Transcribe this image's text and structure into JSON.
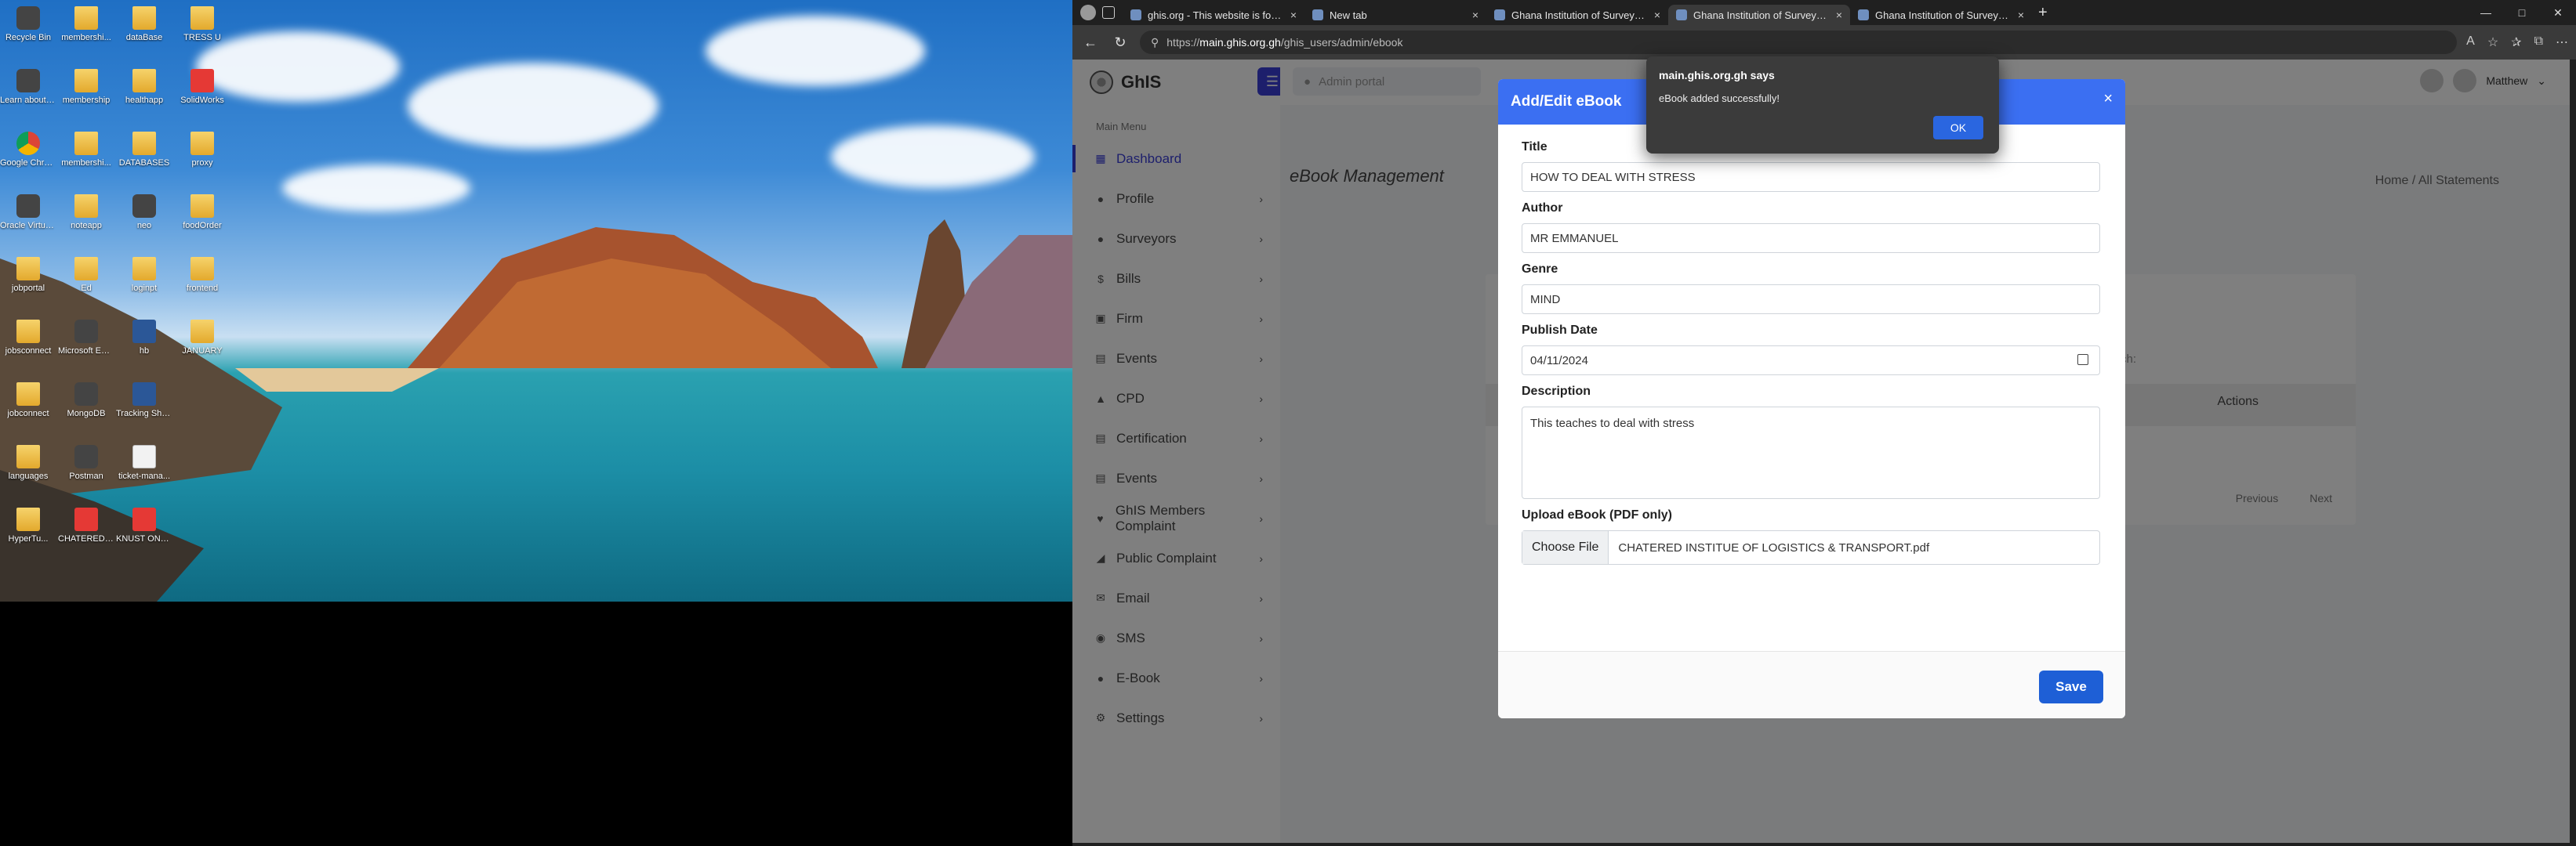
{
  "desktop": {
    "icons": [
      {
        "label": "Recycle Bin",
        "type": "app"
      },
      {
        "label": "membershi...",
        "type": "folder"
      },
      {
        "label": "dataBase",
        "type": "folder"
      },
      {
        "label": "TRESS U",
        "type": "folder"
      },
      {
        "label": "Learn about this picture",
        "type": "app"
      },
      {
        "label": "membership",
        "type": "folder"
      },
      {
        "label": "healthapp",
        "type": "folder"
      },
      {
        "label": "SolidWorks",
        "type": "pdf"
      },
      {
        "label": "Google Chrome",
        "type": "chrome"
      },
      {
        "label": "membershi...",
        "type": "folder"
      },
      {
        "label": "DATABASES",
        "type": "folder"
      },
      {
        "label": "proxy",
        "type": "folder"
      },
      {
        "label": "Oracle VirtualBox",
        "type": "app"
      },
      {
        "label": "noteapp",
        "type": "folder"
      },
      {
        "label": "neo",
        "type": "app"
      },
      {
        "label": "foodOrder",
        "type": "folder"
      },
      {
        "label": "jobportal",
        "type": "folder"
      },
      {
        "label": "Ed",
        "type": "folder"
      },
      {
        "label": "loginpt",
        "type": "folder"
      },
      {
        "label": "frontend",
        "type": "folder"
      },
      {
        "label": "jobsconnect",
        "type": "folder"
      },
      {
        "label": "Microsoft Edge",
        "type": "app"
      },
      {
        "label": "hb",
        "type": "word"
      },
      {
        "label": "JANUARY",
        "type": "folder"
      },
      {
        "label": "jobconnect",
        "type": "folder"
      },
      {
        "label": "MongoDB",
        "type": "app"
      },
      {
        "label": "Tracking Shooting",
        "type": "word"
      },
      {
        "label": "languages",
        "type": "folder"
      },
      {
        "label": "Postman",
        "type": "app"
      },
      {
        "label": "ticket-mana...",
        "type": "doc"
      },
      {
        "label": "HyperTu...",
        "type": "folder"
      },
      {
        "label": "CHATERED INSTITUTE...",
        "type": "pdf"
      },
      {
        "label": "KNUST ONLINE A...",
        "type": "pdf"
      }
    ]
  },
  "browser": {
    "tabs": [
      {
        "title": "ghis.org - This website is for sale",
        "active": false
      },
      {
        "title": "New tab",
        "active": false
      },
      {
        "title": "Ghana Institution of Surveyors (G...",
        "active": false
      },
      {
        "title": "Ghana Institution of Surveyors (G...",
        "active": true
      },
      {
        "title": "Ghana Institution of Surveyors (G...",
        "active": false
      }
    ],
    "url_prefix": "https://",
    "url_host": "main.ghis.org.gh",
    "url_path": "/ghis_users/admin/ebook",
    "window_controls": [
      "—",
      "□",
      "✕"
    ]
  },
  "app": {
    "brand": "GhIS",
    "search_placeholder": "Admin portal",
    "menu_title": "Main Menu",
    "menu_items": [
      {
        "label": "Dashboard",
        "icon": "dashboard-icon",
        "glyph": "▦",
        "chevron": false,
        "active": true
      },
      {
        "label": "Profile",
        "icon": "user-icon",
        "glyph": "●",
        "chevron": true
      },
      {
        "label": "Surveyors",
        "icon": "users-icon",
        "glyph": "●",
        "chevron": true
      },
      {
        "label": "Bills",
        "icon": "dollar-icon",
        "glyph": "$",
        "chevron": true
      },
      {
        "label": "Firm",
        "icon": "building-icon",
        "glyph": "▣",
        "chevron": true
      },
      {
        "label": "Events",
        "icon": "calendar-icon",
        "glyph": "▤",
        "chevron": true
      },
      {
        "label": "CPD",
        "icon": "cap-icon",
        "glyph": "▲",
        "chevron": true
      },
      {
        "label": "Certification",
        "icon": "certificate-icon",
        "glyph": "▤",
        "chevron": true
      },
      {
        "label": "Events",
        "icon": "calendar-icon",
        "glyph": "▤",
        "chevron": true
      },
      {
        "label": "GhIS Members Complaint",
        "icon": "heart-icon",
        "glyph": "♥",
        "chevron": true
      },
      {
        "label": "Public Complaint",
        "icon": "megaphone-icon",
        "glyph": "◢",
        "chevron": true
      },
      {
        "label": "Email",
        "icon": "envelope-icon",
        "glyph": "✉",
        "chevron": true
      },
      {
        "label": "SMS",
        "icon": "chat-icon",
        "glyph": "◉",
        "chevron": true
      },
      {
        "label": "E-Book",
        "icon": "book-icon",
        "glyph": "●",
        "chevron": true
      },
      {
        "label": "Settings",
        "icon": "gear-icon",
        "glyph": "⚙",
        "chevron": true
      }
    ],
    "user_name": "Matthew",
    "page_title": "eBook Management",
    "breadcrumb": "Home  /  All Statements",
    "table_actions_header": "Actions",
    "table_search": "Search:",
    "pager_prev": "Previous",
    "pager_next": "Next"
  },
  "modal": {
    "title": "Add/Edit eBook",
    "close": "×",
    "fields": {
      "title_label": "Title",
      "title_value": "HOW TO DEAL WITH STRESS",
      "author_label": "Author",
      "author_value": "MR EMMANUEL",
      "genre_label": "Genre",
      "genre_value": "MIND",
      "date_label": "Publish Date",
      "date_value": "04/11/2024",
      "desc_label": "Description",
      "desc_value": "This teaches to deal with stress",
      "upload_label": "Upload eBook (PDF only)",
      "choose_file": "Choose File",
      "file_name": "CHATERED INSTITUE OF LOGISTICS & TRANSPORT.pdf"
    },
    "save": "Save"
  },
  "alert": {
    "origin": "main.ghis.org.gh says",
    "message": "eBook added successfully!",
    "ok": "OK"
  }
}
